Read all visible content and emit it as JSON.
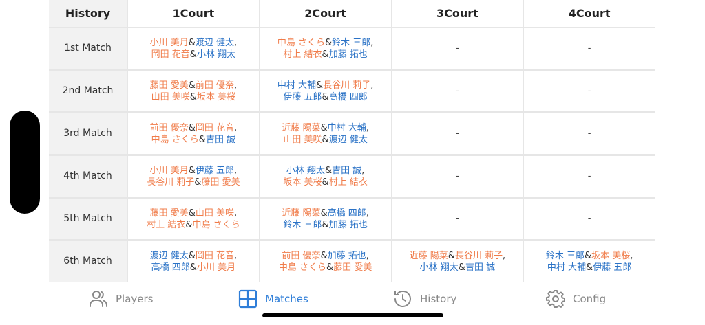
{
  "table": {
    "headers": [
      "History",
      "1Court",
      "2Court",
      "3Court",
      "4Court"
    ],
    "rows": [
      {
        "label": "1st Match",
        "courts": [
          {
            "l1": [
              {
                "t": "小川 美月",
                "c": "orange"
              },
              {
                "t": "渡辺 健太",
                "c": "blue"
              }
            ],
            "l2": [
              {
                "t": "岡田 花音",
                "c": "orange"
              },
              {
                "t": "小林 翔太",
                "c": "blue"
              }
            ]
          },
          {
            "l1": [
              {
                "t": "中島 さくら",
                "c": "orange"
              },
              {
                "t": "鈴木 三郎",
                "c": "blue"
              }
            ],
            "l2": [
              {
                "t": "村上 結衣",
                "c": "orange"
              },
              {
                "t": "加藤 拓也",
                "c": "blue"
              }
            ]
          },
          null,
          null
        ]
      },
      {
        "label": "2nd Match",
        "courts": [
          {
            "l1": [
              {
                "t": "藤田 愛美",
                "c": "orange"
              },
              {
                "t": "前田 優奈",
                "c": "orange"
              }
            ],
            "l2": [
              {
                "t": "山田 美咲",
                "c": "orange"
              },
              {
                "t": "坂本 美桜",
                "c": "orange"
              }
            ]
          },
          {
            "l1": [
              {
                "t": "中村 大輔",
                "c": "blue"
              },
              {
                "t": "長谷川 莉子",
                "c": "orange"
              }
            ],
            "l2": [
              {
                "t": "伊藤 五郎",
                "c": "blue"
              },
              {
                "t": "高橋 四郎",
                "c": "blue"
              }
            ]
          },
          null,
          null
        ]
      },
      {
        "label": "3rd Match",
        "courts": [
          {
            "l1": [
              {
                "t": "前田 優奈",
                "c": "orange"
              },
              {
                "t": "岡田 花音",
                "c": "orange"
              }
            ],
            "l2": [
              {
                "t": "中島 さくら",
                "c": "orange"
              },
              {
                "t": "吉田 誠",
                "c": "blue"
              }
            ]
          },
          {
            "l1": [
              {
                "t": "近藤 陽菜",
                "c": "orange"
              },
              {
                "t": "中村 大輔",
                "c": "blue"
              }
            ],
            "l2": [
              {
                "t": "山田 美咲",
                "c": "orange"
              },
              {
                "t": "渡辺 健太",
                "c": "blue"
              }
            ]
          },
          null,
          null
        ]
      },
      {
        "label": "4th Match",
        "courts": [
          {
            "l1": [
              {
                "t": "小川 美月",
                "c": "orange"
              },
              {
                "t": "伊藤 五郎",
                "c": "blue"
              }
            ],
            "l2": [
              {
                "t": "長谷川 莉子",
                "c": "orange"
              },
              {
                "t": "藤田 愛美",
                "c": "orange"
              }
            ]
          },
          {
            "l1": [
              {
                "t": "小林 翔太",
                "c": "blue"
              },
              {
                "t": "吉田 誠",
                "c": "blue"
              }
            ],
            "l2": [
              {
                "t": "坂本 美桜",
                "c": "orange"
              },
              {
                "t": "村上 結衣",
                "c": "orange"
              }
            ]
          },
          null,
          null
        ]
      },
      {
        "label": "5th Match",
        "courts": [
          {
            "l1": [
              {
                "t": "藤田 愛美",
                "c": "orange"
              },
              {
                "t": "山田 美咲",
                "c": "orange"
              }
            ],
            "l2": [
              {
                "t": "村上 結衣",
                "c": "orange"
              },
              {
                "t": "中島 さくら",
                "c": "orange"
              }
            ]
          },
          {
            "l1": [
              {
                "t": "近藤 陽菜",
                "c": "orange"
              },
              {
                "t": "高橋 四郎",
                "c": "blue"
              }
            ],
            "l2": [
              {
                "t": "鈴木 三郎",
                "c": "blue"
              },
              {
                "t": "加藤 拓也",
                "c": "blue"
              }
            ]
          },
          null,
          null
        ]
      },
      {
        "label": "6th Match",
        "courts": [
          {
            "l1": [
              {
                "t": "渡辺 健太",
                "c": "blue"
              },
              {
                "t": "岡田 花音",
                "c": "orange"
              }
            ],
            "l2": [
              {
                "t": "高橋 四郎",
                "c": "blue"
              },
              {
                "t": "小川 美月",
                "c": "orange"
              }
            ]
          },
          {
            "l1": [
              {
                "t": "前田 優奈",
                "c": "orange"
              },
              {
                "t": "加藤 拓也",
                "c": "blue"
              }
            ],
            "l2": [
              {
                "t": "中島 さくら",
                "c": "orange"
              },
              {
                "t": "藤田 愛美",
                "c": "orange"
              }
            ]
          },
          {
            "l1": [
              {
                "t": "近藤 陽菜",
                "c": "orange"
              },
              {
                "t": "長谷川 莉子",
                "c": "orange"
              }
            ],
            "l2": [
              {
                "t": "小林 翔太",
                "c": "blue"
              },
              {
                "t": "吉田 誠",
                "c": "blue"
              }
            ]
          },
          {
            "l1": [
              {
                "t": "鈴木 三郎",
                "c": "blue"
              },
              {
                "t": "坂本 美桜",
                "c": "orange"
              }
            ],
            "l2": [
              {
                "t": "中村 大輔",
                "c": "blue"
              },
              {
                "t": "伊藤 五郎",
                "c": "blue"
              }
            ]
          }
        ]
      }
    ],
    "pair_joiner": "&",
    "pair_comma": ",",
    "empty_cell": "-"
  },
  "tabbar": {
    "items": [
      {
        "label": "Players",
        "icon": "users-icon",
        "active": false
      },
      {
        "label": "Matches",
        "icon": "grid-icon",
        "active": true
      },
      {
        "label": "History",
        "icon": "history-icon",
        "active": false
      },
      {
        "label": "Config",
        "icon": "gear-icon",
        "active": false
      }
    ]
  },
  "colors": {
    "female": "#f07c4a",
    "male": "#2a72c6",
    "active_tab": "#2f7ed8",
    "inactive_tab": "#888888"
  }
}
